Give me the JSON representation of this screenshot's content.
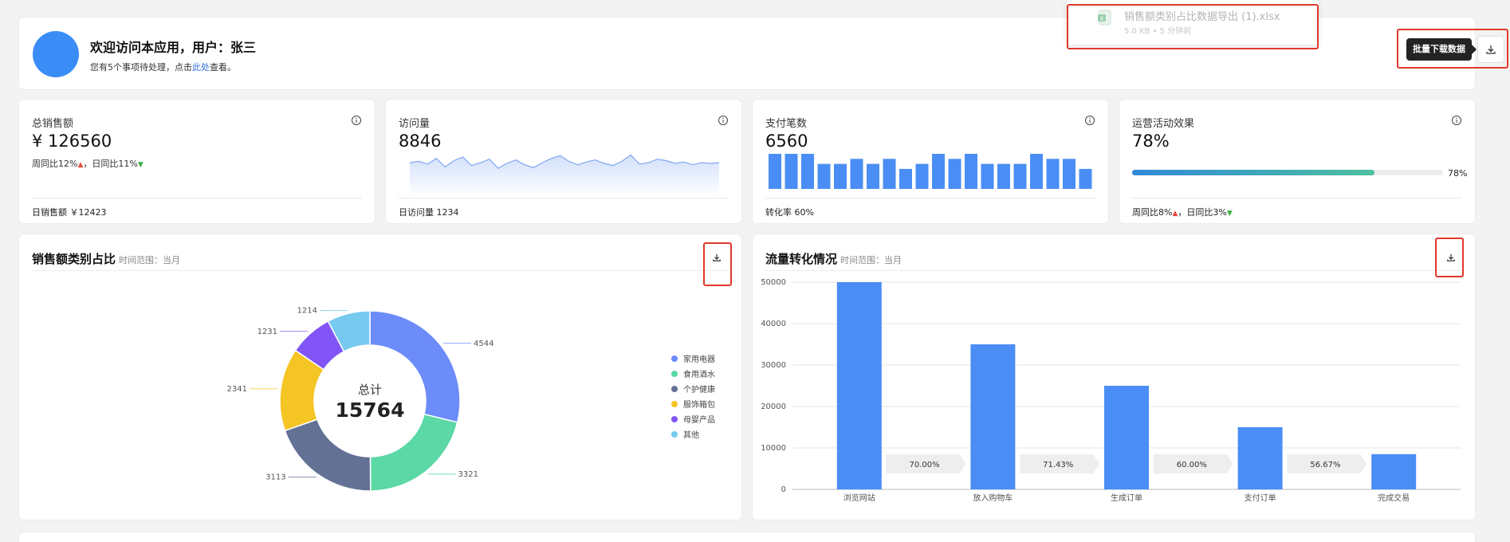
{
  "welcome": {
    "title": "欢迎访问本应用，用户：张三",
    "sub_prefix": "您有5个事项待处理，点击",
    "sub_link": "此处",
    "sub_suffix": "查看。"
  },
  "download": {
    "file_name": "销售额类别占比数据导出 (1).xlsx",
    "file_meta": "5.0 KB • 5 分钟前",
    "tooltip": "批量下载数据",
    "file_icon": "excel-file-icon",
    "button_icon": "download-icon"
  },
  "stats": [
    {
      "title": "总销售额",
      "value": "¥ 126560",
      "sub": "周同比12%",
      "sub2": "，日同比11%",
      "foot": "日销售额 ￥12423"
    },
    {
      "title": "访问量",
      "value": "8846",
      "foot": "日访问量 1234"
    },
    {
      "title": "支付笔数",
      "value": "6560",
      "foot": "转化率 60%"
    },
    {
      "title": "运营活动效果",
      "value": "78%",
      "progress": 0.78,
      "progress_label": "78%",
      "foot": "周同比8%",
      "foot2": "，日同比3%"
    }
  ],
  "panels": {
    "pie": {
      "title": "销售额类别占比",
      "range": "时间范围：当月",
      "center_label": "总计",
      "center_value": "15764"
    },
    "bar": {
      "title": "流量转化情况",
      "range": "时间范围：当月"
    }
  },
  "colors": {
    "accent": "#3a8df7",
    "bar": "#4a8ef5",
    "up": "#e84b3c",
    "down": "#3cb043",
    "annotation": "#e0392b"
  },
  "chart_data": [
    {
      "type": "area",
      "values": [
        44,
        46,
        42,
        50,
        38,
        47,
        52,
        40,
        44,
        49,
        36,
        43,
        48,
        41,
        37,
        44,
        50,
        54,
        46,
        41,
        45,
        48,
        43,
        40,
        46,
        55,
        42,
        44,
        49,
        47,
        43,
        45,
        41,
        44,
        43,
        44
      ]
    },
    {
      "type": "bar",
      "values": [
        7,
        7,
        7,
        5,
        5,
        6,
        5,
        6,
        4,
        5,
        7,
        6,
        7,
        5,
        5,
        5,
        7,
        6,
        6,
        4
      ]
    },
    {
      "type": "pie",
      "title": "销售额类别占比",
      "slices": [
        {
          "name": "家用电器",
          "value": 4544,
          "color": "#6b8cf9"
        },
        {
          "name": "食用酒水",
          "value": 3321,
          "color": "#5bd8a6"
        },
        {
          "name": "个护健康",
          "value": 3113,
          "color": "#637195"
        },
        {
          "name": "服饰箱包",
          "value": 2341,
          "color": "#f5c425"
        },
        {
          "name": "母婴产品",
          "value": 1231,
          "color": "#8155f5"
        },
        {
          "name": "其他",
          "value": 1214,
          "color": "#77c9f0"
        }
      ],
      "total": 15764
    },
    {
      "type": "bar",
      "title": "流量转化情况",
      "categories": [
        "浏览网站",
        "放入购物车",
        "生成订单",
        "支付订单",
        "完成交易"
      ],
      "values": [
        50000,
        35000,
        25000,
        15000,
        8500
      ],
      "conversions": [
        "70.00%",
        "71.43%",
        "60.00%",
        "56.67%"
      ],
      "ylim": [
        0,
        50000
      ],
      "yticks": [
        0,
        10000,
        20000,
        30000,
        40000,
        50000
      ],
      "grid": true
    }
  ]
}
